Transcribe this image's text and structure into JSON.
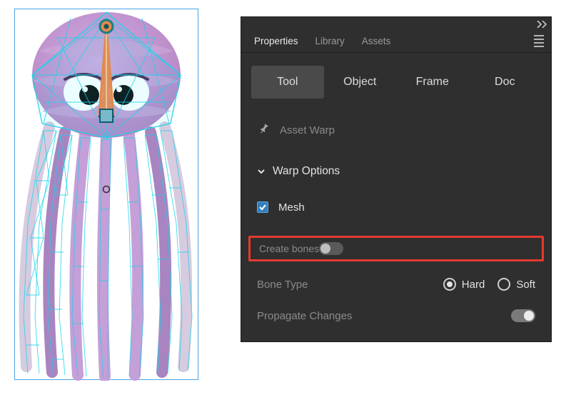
{
  "panel": {
    "tabs": [
      {
        "label": "Properties",
        "active": true
      },
      {
        "label": "Library",
        "active": false
      },
      {
        "label": "Assets",
        "active": false
      }
    ],
    "segments": [
      {
        "label": "Tool",
        "active": true
      },
      {
        "label": "Object",
        "active": false
      },
      {
        "label": "Frame",
        "active": false
      },
      {
        "label": "Doc",
        "active": false
      }
    ],
    "tool_name": "Asset Warp",
    "section_title": "Warp Options",
    "options": {
      "mesh_label": "Mesh",
      "mesh_checked": true,
      "create_bones_label": "Create bones",
      "create_bones_on": false,
      "bone_type_label": "Bone Type",
      "bone_type_options": {
        "hard": "Hard",
        "soft": "Soft"
      },
      "bone_type_value": "hard",
      "propagate_label": "Propagate Changes",
      "propagate_on": true
    }
  },
  "colors": {
    "highlight": "#e33b2e",
    "mesh": "#18d4ea",
    "selection": "#4aa3e3"
  }
}
